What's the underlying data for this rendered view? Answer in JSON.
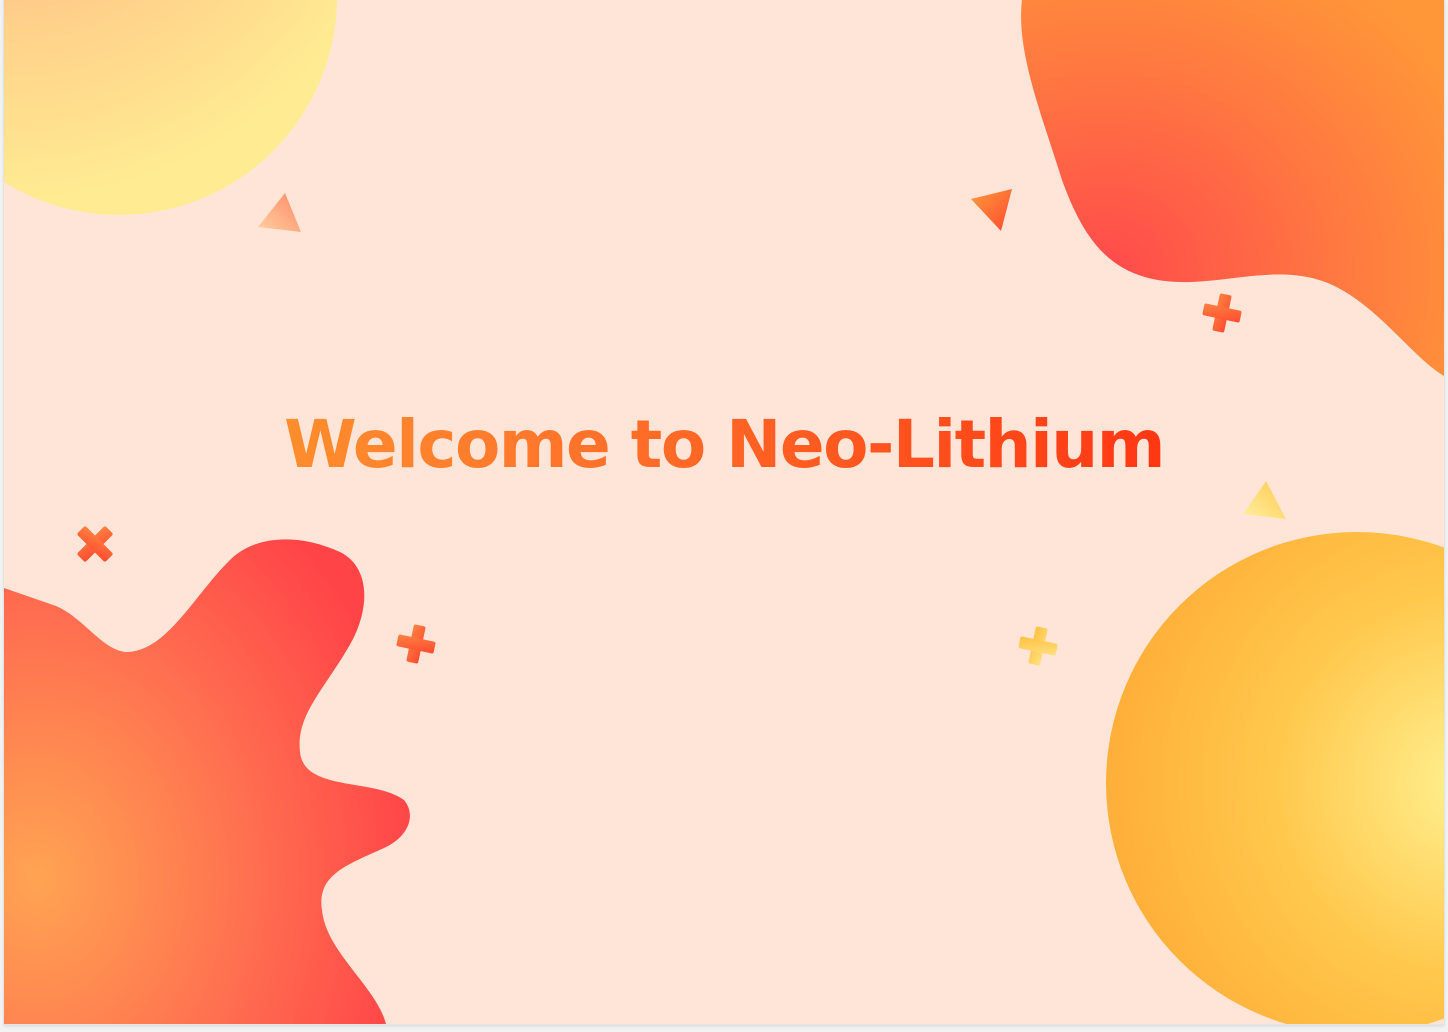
{
  "slide": {
    "title": "Welcome to Neo-Lithium"
  },
  "colors": {
    "background": "#ffe5d8",
    "accent_red": "#ff4848",
    "accent_orange": "#ff8a3d",
    "accent_yellow": "#ffe98a",
    "title_gradient_start": "#ffa62c",
    "title_gradient_end": "#ff1a08"
  },
  "decorations": [
    "sun-circle-top-left",
    "blob-top-right",
    "blob-bottom-left",
    "sun-circle-bottom-right",
    "triangle-icon",
    "plus-icon",
    "cross-icon"
  ]
}
